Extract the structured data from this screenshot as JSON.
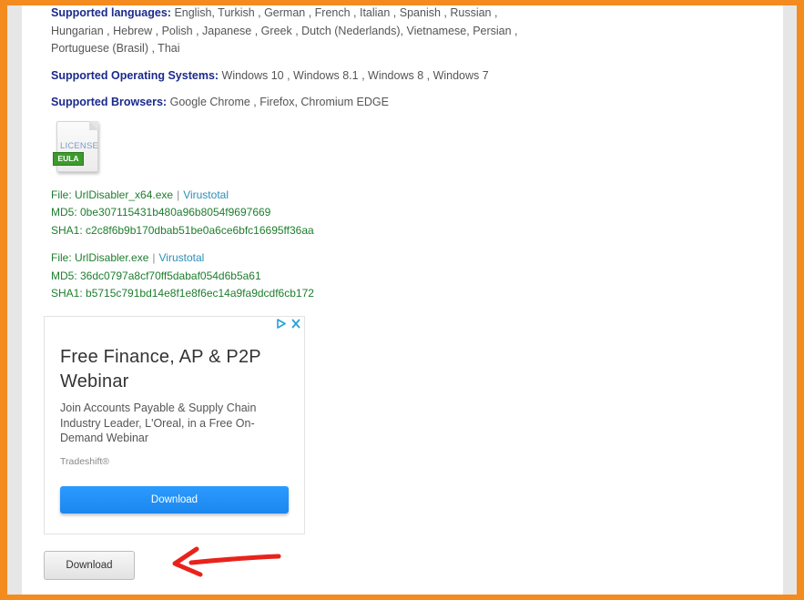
{
  "info": {
    "languages_label": "Supported languages:",
    "languages_value": "English, Turkish , German , French , Italian , Spanish , Russian , Hungarian , Hebrew , Polish , Japanese , Greek , Dutch (Nederlands), Vietnamese, Persian , Portuguese (Brasil) , Thai",
    "os_label": "Supported Operating Systems:",
    "os_value": "Windows 10 , Windows 8.1 , Windows 8 , Windows 7",
    "browsers_label": "Supported Browsers:",
    "browsers_value": "Google Chrome , Firefox, Chromium EDGE"
  },
  "license_icon": {
    "text": "LICENSE",
    "badge": "EULA"
  },
  "files": [
    {
      "file_line": "File: UrlDisabler_x64.exe",
      "separator": "|",
      "virustotal": "Virustotal",
      "md5": "MD5: 0be307115431b480a96b8054f9697669",
      "sha1": "SHA1: c2c8f6b9b170dbab51be0a6ce6bfc16695ff36aa"
    },
    {
      "file_line": "File: UrlDisabler.exe",
      "separator": "|",
      "virustotal": "Virustotal",
      "md5": "MD5: 36dc0797a8cf70ff5dabaf054d6b5a61",
      "sha1": "SHA1: b5715c791bd14e8f1e8f6ec14a9fa9dcdf6cb172"
    }
  ],
  "ad": {
    "title": "Free Finance, AP & P2P Webinar",
    "body": "Join Accounts Payable & Supply Chain Industry Leader, L'Oreal, in a Free On-Demand Webinar",
    "brand": "Tradeshift®",
    "button_label": "Download"
  },
  "main_download": {
    "label": "Download"
  },
  "colors": {
    "frame": "#f48b1f",
    "label_blue": "#1a2a8c",
    "file_green": "#1e7d2e",
    "link_blue": "#2a8fb5",
    "ad_button": "#1a87ee",
    "arrow_red": "#e8231c"
  }
}
